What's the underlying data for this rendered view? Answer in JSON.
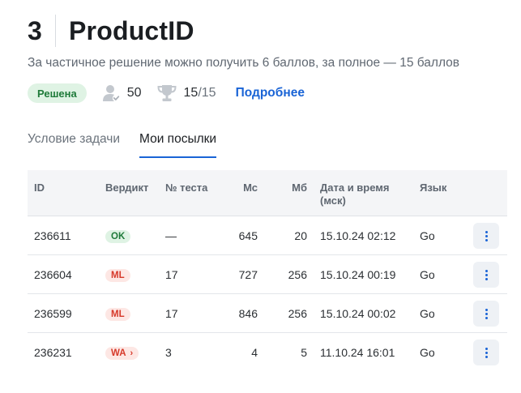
{
  "task": {
    "number": "3",
    "title": "ProductID",
    "subtitle": "За частичное решение можно получить 6 баллов, за полное — 15 баллов",
    "status_badge": "Решена",
    "solved_count": "50",
    "score_main": "15",
    "score_total": "/15",
    "more_link": "Подробнее"
  },
  "tabs": [
    {
      "label": "Условие задачи",
      "active": false
    },
    {
      "label": "Мои посылки",
      "active": true
    }
  ],
  "table": {
    "headers": {
      "id": "ID",
      "verdict": "Вердикт",
      "test": "№ теста",
      "ms": "Мс",
      "mb": "Мб",
      "date_line1": "Дата и время",
      "date_line2": "(мск)",
      "lang": "Язык"
    },
    "rows": [
      {
        "id": "236611",
        "verdict": "OK",
        "test": "—",
        "ms": "645",
        "mb": "20",
        "date": "15.10.24 02:12",
        "lang": "Go"
      },
      {
        "id": "236604",
        "verdict": "ML",
        "test": "17",
        "ms": "727",
        "mb": "256",
        "date": "15.10.24 00:19",
        "lang": "Go"
      },
      {
        "id": "236599",
        "verdict": "ML",
        "test": "17",
        "ms": "846",
        "mb": "256",
        "date": "15.10.24 00:02",
        "lang": "Go"
      },
      {
        "id": "236231",
        "verdict": "WA",
        "test": "3",
        "ms": "4",
        "mb": "5",
        "date": "11.10.24 16:01",
        "lang": "Go"
      }
    ]
  },
  "icons": {
    "solved_users": "users-check-icon",
    "score": "trophy-icon",
    "row_menu": "more-vertical-icon",
    "wa_expand": "chevron-right-icon"
  },
  "colors": {
    "accent": "#1a64d6",
    "ok_bg": "#dff3e4",
    "ok_text": "#1e7a39",
    "error_bg": "#fde7e4",
    "error_text": "#d6392a"
  }
}
